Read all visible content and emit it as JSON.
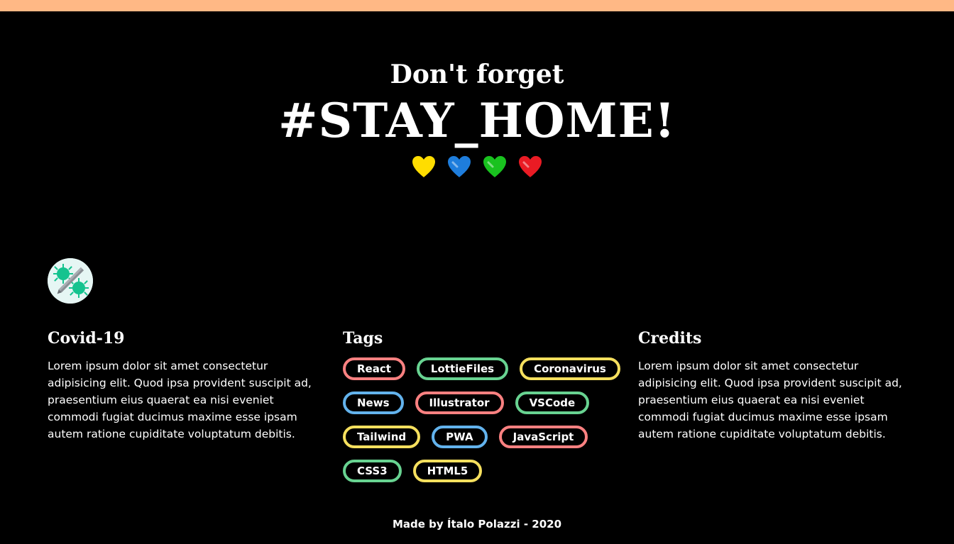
{
  "hero": {
    "subtitle": "Don't forget",
    "title": "#STAY_HOME!",
    "hearts": [
      {
        "icon": "yellow-heart-icon",
        "color": "#ffdd00"
      },
      {
        "icon": "blue-heart-icon",
        "color": "#1e7ddc"
      },
      {
        "icon": "green-heart-icon",
        "color": "#19c21f"
      },
      {
        "icon": "red-heart-icon",
        "color": "#ea1b24"
      }
    ]
  },
  "accent": {
    "top_bar": "#ffb885"
  },
  "logo": {
    "icon": "virus-syringe-icon"
  },
  "covid": {
    "heading": "Covid-19",
    "text": "Lorem ipsum dolor sit amet consectetur adipisicing elit. Quod ipsa provident suscipit ad, praesentium eius quaerat ea nisi eveniet commodi fugiat ducimus maxime esse ipsam autem ratione cupiditate voluptatum debitis."
  },
  "tags": {
    "heading": "Tags",
    "items": [
      {
        "label": "React",
        "color": "#fc8181"
      },
      {
        "label": "LottieFiles",
        "color": "#68d391"
      },
      {
        "label": "Coronavirus",
        "color": "#f6e05e"
      },
      {
        "label": "News",
        "color": "#63b3ed"
      },
      {
        "label": "Illustrator",
        "color": "#fc8181"
      },
      {
        "label": "VSCode",
        "color": "#68d391"
      },
      {
        "label": "Tailwind",
        "color": "#f6e05e"
      },
      {
        "label": "PWA",
        "color": "#63b3ed"
      },
      {
        "label": "JavaScript",
        "color": "#fc8181"
      },
      {
        "label": "CSS3",
        "color": "#68d391"
      },
      {
        "label": "HTML5",
        "color": "#f6e05e"
      }
    ]
  },
  "credits": {
    "heading": "Credits",
    "text": "Lorem ipsum dolor sit amet consectetur adipisicing elit. Quod ipsa provident suscipit ad, praesentium eius quaerat ea nisi eveniet commodi fugiat ducimus maxime esse ipsam autem ratione cupiditate voluptatum debitis."
  },
  "footer": {
    "text": "Made by Ítalo Polazzi - 2020"
  }
}
